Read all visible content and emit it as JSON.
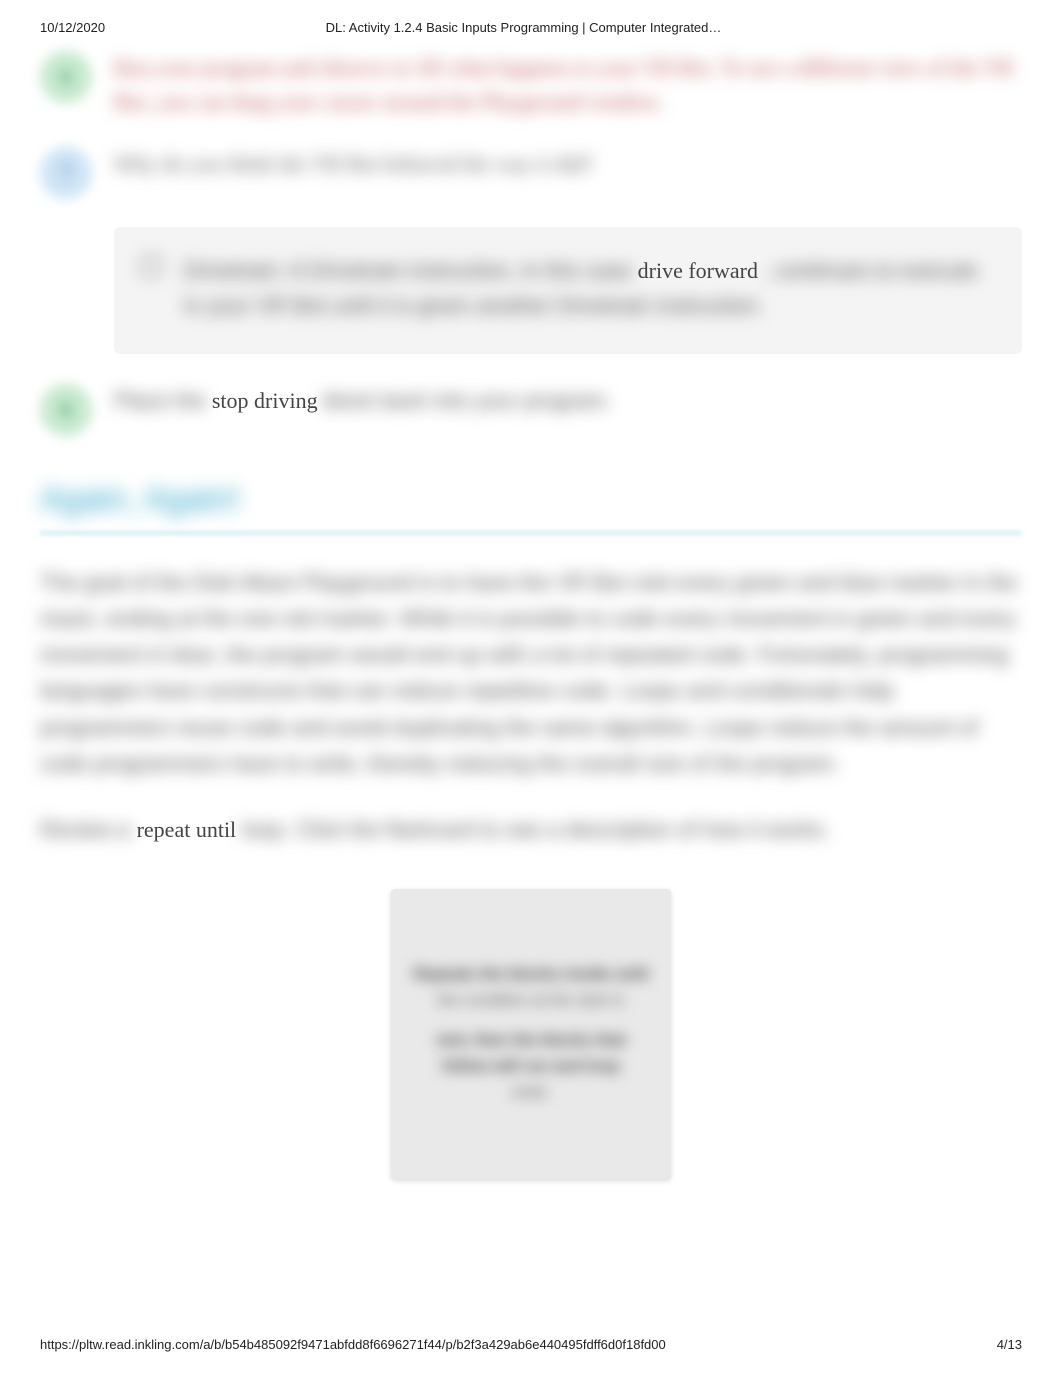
{
  "header": {
    "date": "10/12/2020",
    "title": "DL: Activity 1.2.4 Basic Inputs Programming | Computer Integrated…"
  },
  "steps": {
    "six": {
      "num": "6",
      "text": "Run your program and observe in 3D what happens to your VR Bot. To see a different view of the VR Bot, you can drag your cursor around the Playground window."
    },
    "seven": {
      "num": "7",
      "text": "Why do you think the VR Bot behaved the way it did?"
    },
    "eight": {
      "num": "8",
      "prefix": "Place the ",
      "clear": "stop driving",
      "suffix": " block back into your program."
    }
  },
  "infobox": {
    "lead_blur": "Drivetrain: A Drivetrain instruction, in this case ",
    "clear": "drive forward",
    "tail_blur": ", continues to execute in your VR Bot until it is given another Drivetrain instruction."
  },
  "section": {
    "heading": "Again, Again!"
  },
  "paragraph": {
    "text": "The goal of the Disk Maze Playground is to have the VR Bot visit every green and blue marker in the maze, ending at the one red marker. While it is possible to code every movement in green and every movement in blue, the program would end up with a lot of repeated code. Fortunately, programming languages have constructs that can reduce repetitive code. Loops and conditionals help programmers reuse code and avoid duplicating the same algorithm. Loops reduce the amount of code programmers have to write, thereby reducing the overall size of the program."
  },
  "para2": {
    "prefix_blur": "Review a ",
    "clear": "repeat until",
    "suffix_blur": " loop. Click the flashcard to see a description of how it works."
  },
  "flashcard": {
    "line1": "Repeats the blocks inside until",
    "line2": "the condition at the start is",
    "line3": "met; then the blocks that",
    "line4": "follow will run and loop",
    "line5": "ends."
  },
  "footer": {
    "url": "https://pltw.read.inkling.com/a/b/b54b485092f9471abfdd8f6696271f44/p/b2f3a429ab6e440495fdff6d0f18fd00",
    "page": "4/13"
  }
}
